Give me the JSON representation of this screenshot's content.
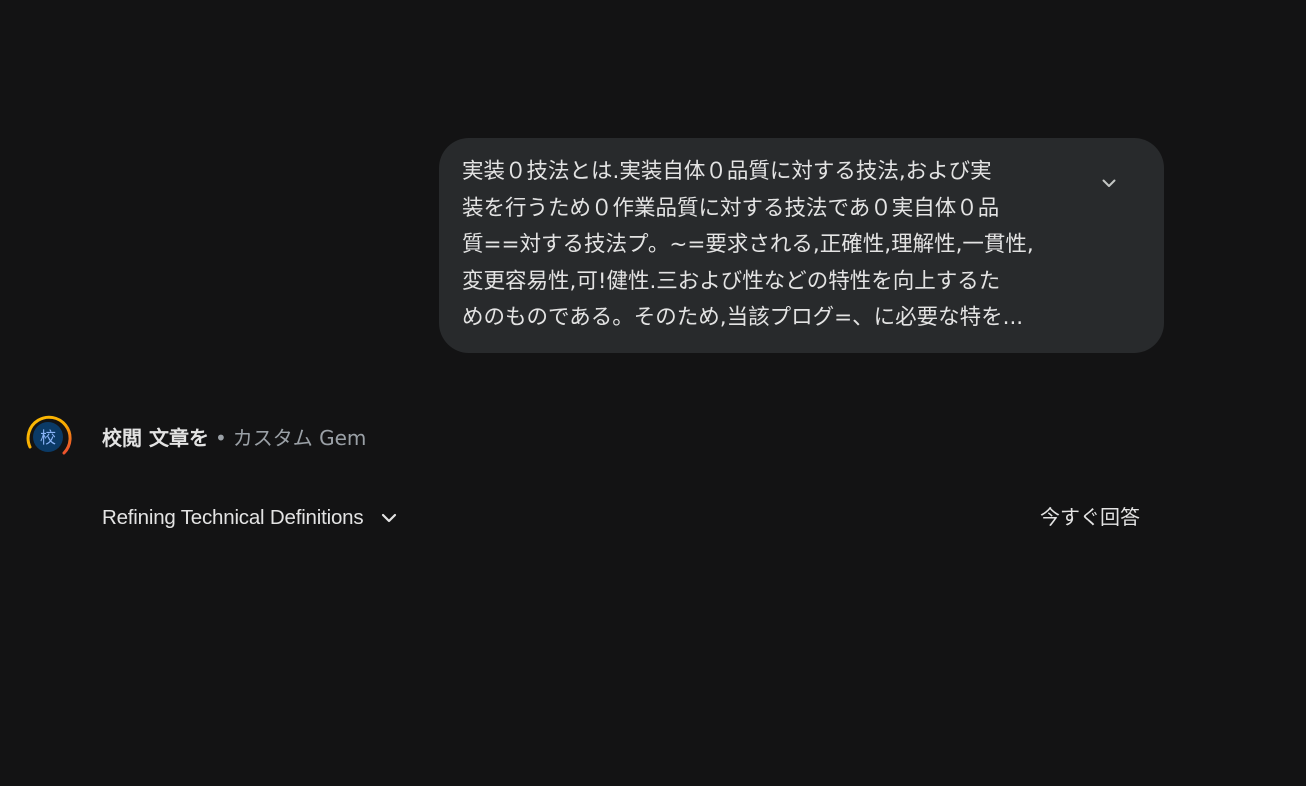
{
  "user_message": {
    "lines": [
      "実装０技法とは.実装自体０品質に対する技法,および実",
      "装を行うため０作業品質に対する技法であ０実自体０品",
      "質==対する技法プ。~=要求される,正確性,理解性,一貫性,",
      "変更容易性,可!健性.三および性などの特性を向上するた",
      "めのものである。そのため,当該プログ=、に必要な特を..."
    ],
    "expand_icon": "chevron-down-icon"
  },
  "response": {
    "avatar_glyph": "校",
    "gem_name": "校閲 文章を",
    "separator": "•",
    "gem_type": "カスタム Gem",
    "thinking_title": "Refining Technical Definitions",
    "thinking_icon": "chevron-down-icon",
    "answer_now_label": "今すぐ回答"
  },
  "colors": {
    "background": "#131314",
    "bubble": "#282a2c",
    "text_primary": "#e3e3e3",
    "text_secondary": "#9aa0a6",
    "avatar_fill": "#0b3a66",
    "avatar_ring_start": "#fbbc04",
    "avatar_ring_end": "#ea4335"
  }
}
